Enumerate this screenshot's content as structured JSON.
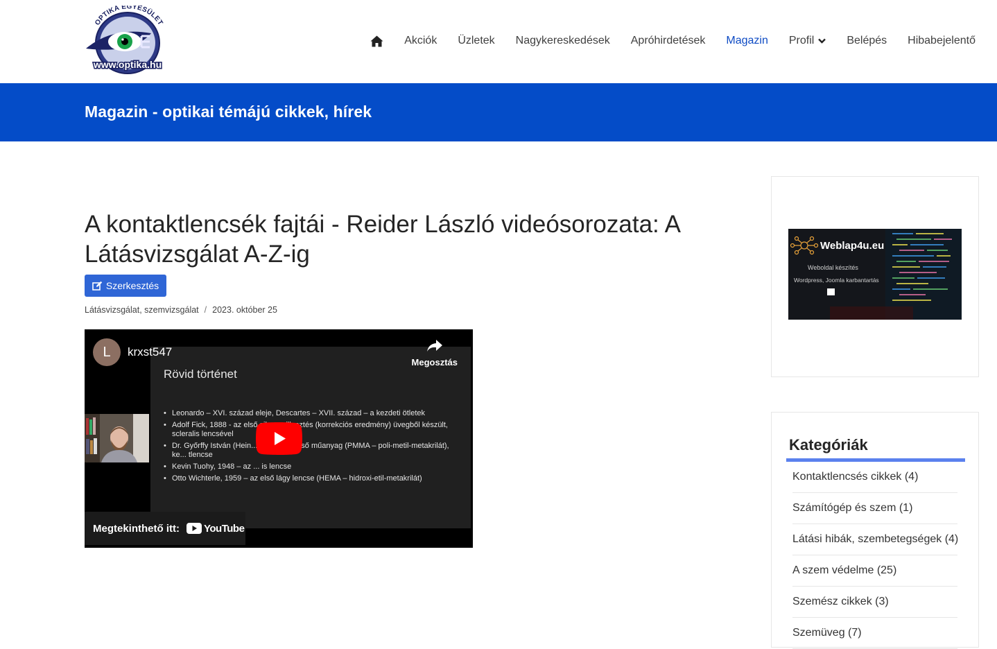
{
  "logo": {
    "arc_text": "OPTIKA EGYESÜLET",
    "url_text": "www.optika.hu"
  },
  "nav": {
    "home_icon": "home-icon",
    "items": [
      {
        "label": "Akciók"
      },
      {
        "label": "Üzletek"
      },
      {
        "label": "Nagykereskedések"
      },
      {
        "label": "Apróhirdetések"
      },
      {
        "label": "Magazin",
        "active": true
      },
      {
        "label": "Profil",
        "dropdown": true
      },
      {
        "label": "Belépés"
      },
      {
        "label": "Hibabejelentő"
      }
    ],
    "active_color": "#0e4bc4"
  },
  "banner": {
    "title": "Magazin - optikai témájú cikkek, hírek",
    "color": "#044cc8"
  },
  "article": {
    "title": "A kontaktlencsék fajtái - Reider László videósorozata: A Látásvizsgálat A-Z-ig",
    "edit_label": "Szerkesztés",
    "category": "Látásvizsgálat, szemvizsgálat",
    "separator": "/",
    "date": "2023. október 25"
  },
  "video": {
    "avatar_letter": "L",
    "channel": "krxst547",
    "share_label": "Megosztás",
    "slide_title": "Rövid történet",
    "bullets": [
      "Leonardo – XVI. század eleje, Descartes – XVII. század – a kezdeti ötletek",
      "Adolf Fick, 1888 - az első sikeres illesztés (korrekciós eredmény) üvegből készült, scleralis lencsével",
      "Dr. Győrffy István (Hein... 1939 – az első műanyag (PMMA – poli-metil-metakrilát), ke... tlencse",
      "Kevin Tuohy, 1948 – az ... is lencse",
      "Otto Wichterle, 1959 – az első lágy lencse (HEMA – hidroxi-etil-metakrilát)"
    ],
    "watch_label": "Megtekinthető itt:",
    "youtube_label": "YouTube"
  },
  "sidebar": {
    "ad": {
      "brand": "Weblap4u.eu",
      "line1": "Weboldal készítés",
      "line2": "Wordpress, Joomla karbantartás"
    },
    "categories_title": "Kategóriák",
    "categories": [
      "Kontaktlencsés cikkek (4)",
      "Számítógép és szem (1)",
      "Látási hibák, szembetegségek (4)",
      "A szem védelme (25)",
      "Szemész cikkek (3)",
      "Szemüveg (7)"
    ],
    "accent": "#5b81ee"
  }
}
